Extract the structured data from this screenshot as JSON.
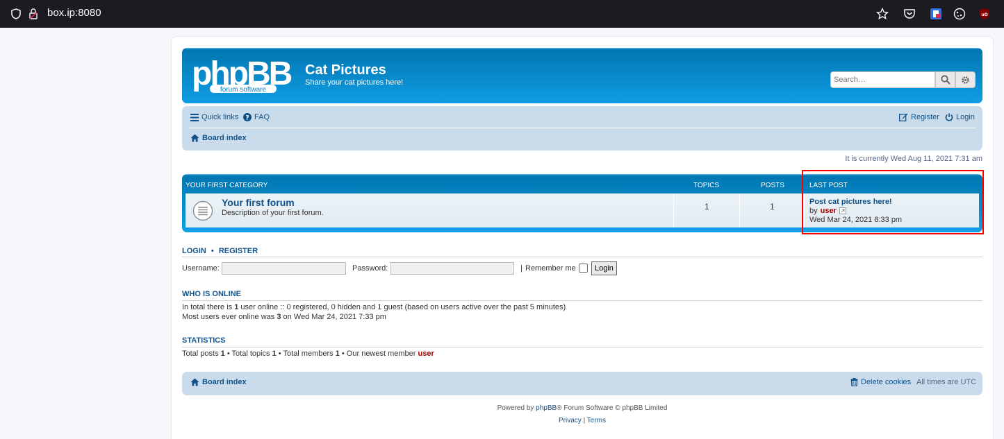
{
  "browser": {
    "url": "box.ip:8080"
  },
  "header": {
    "logo_text": "phpBB",
    "logo_sub": "forum  software",
    "title": "Cat Pictures",
    "description": "Share your cat pictures here!",
    "search_placeholder": "Search…"
  },
  "nav": {
    "quick_links": "Quick links",
    "faq": "FAQ",
    "register": "Register",
    "login": "Login",
    "board_index": "Board index"
  },
  "current_time": "It is currently Wed Aug 11, 2021 7:31 am",
  "category": {
    "name": "YOUR FIRST CATEGORY",
    "col_topics": "TOPICS",
    "col_posts": "POSTS",
    "col_last_post": "LAST POST",
    "forum": {
      "title": "Your first forum",
      "description": "Description of your first forum.",
      "topics": "1",
      "posts": "1",
      "last_post_title": "Post cat pictures here!",
      "last_post_by": "by",
      "last_post_user": "user",
      "last_post_date": "Wed Mar 24, 2021 8:33 pm"
    }
  },
  "login_section": {
    "title_login": "LOGIN",
    "title_sep": "•",
    "title_register": "REGISTER",
    "username_label": "Username:",
    "password_label": "Password:",
    "sep": "|",
    "remember_label": "Remember me",
    "login_button": "Login"
  },
  "online": {
    "title": "WHO IS ONLINE",
    "line1_pre": "In total there is ",
    "line1_num": "1",
    "line1_post": " user online :: 0 registered, 0 hidden and 1 guest (based on users active over the past 5 minutes)",
    "line2_pre": "Most users ever online was ",
    "line2_num": "3",
    "line2_post": " on Wed Mar 24, 2021 7:33 pm"
  },
  "statistics": {
    "title": "STATISTICS",
    "total_posts_label": "Total posts ",
    "total_posts": "1",
    "total_topics_label": " • Total topics ",
    "total_topics": "1",
    "total_members_label": " • Total members ",
    "total_members": "1",
    "newest_label": " • Our newest member ",
    "newest_member": "user"
  },
  "footer": {
    "board_index": "Board index",
    "delete_cookies": "Delete cookies",
    "timezone": "All times are UTC",
    "powered_pre": "Powered by ",
    "powered_link": "phpBB",
    "powered_post": "® Forum Software © phpBB Limited",
    "privacy": "Privacy",
    "sep": "|",
    "terms": "Terms"
  },
  "colors": {
    "link": "#105289",
    "header_blue": "#12A3EB",
    "nav_bg": "#cadceb",
    "username_red": "#AA0000",
    "highlight": "#ff0000"
  }
}
